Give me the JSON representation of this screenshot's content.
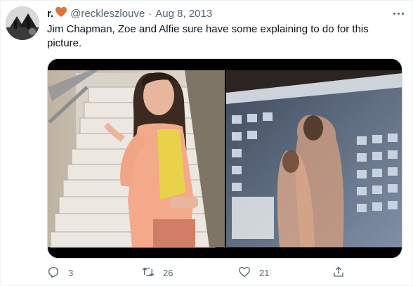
{
  "tweet": {
    "display_name": "r.",
    "heart_emoji": "🧡",
    "handle": "@reckleszlouve",
    "separator": "·",
    "date": "Aug 8, 2013",
    "text": "Jim Chapman, Zoe and Alfie sure have some explaining to do for this picture."
  },
  "actions": {
    "replies": "3",
    "retweets": "26",
    "likes": "21"
  },
  "icons": {
    "avatar": "avatar-icon",
    "more": "more-options-icon",
    "reply": "reply-icon",
    "retweet": "retweet-icon",
    "like": "heart-icon",
    "share": "share-icon"
  },
  "colors": {
    "text_primary": "#0f1419",
    "text_secondary": "#536471",
    "heart": "#e0713a"
  }
}
